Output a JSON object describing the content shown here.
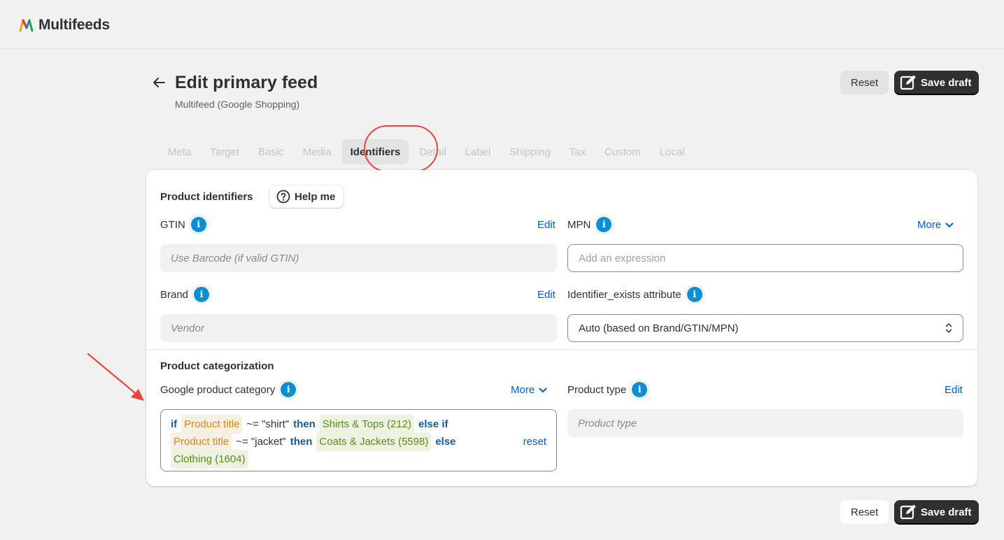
{
  "app": {
    "name": "Multifeeds"
  },
  "header": {
    "title": "Edit primary feed",
    "subtitle": "Multifeed (Google Shopping)",
    "reset_label": "Reset",
    "save_label": "Save draft"
  },
  "tabs": [
    {
      "label": "Meta",
      "active": false
    },
    {
      "label": "Target",
      "active": false
    },
    {
      "label": "Basic",
      "active": false
    },
    {
      "label": "Media",
      "active": false
    },
    {
      "label": "Identifiers",
      "active": true
    },
    {
      "label": "Detail",
      "active": false
    },
    {
      "label": "Label",
      "active": false
    },
    {
      "label": "Shipping",
      "active": false
    },
    {
      "label": "Tax",
      "active": false
    },
    {
      "label": "Custom",
      "active": false
    },
    {
      "label": "Local",
      "active": false
    }
  ],
  "identifiers": {
    "title": "Product identifiers",
    "help_label": "Help me",
    "gtin": {
      "label": "GTIN",
      "action": "Edit",
      "value": "Use Barcode (if valid GTIN)"
    },
    "mpn": {
      "label": "MPN",
      "action": "More",
      "placeholder": "Add an expression"
    },
    "brand": {
      "label": "Brand",
      "action": "Edit",
      "value": "Vendor"
    },
    "identifier_exists": {
      "label": "Identifier_exists attribute",
      "selected": "Auto (based on Brand/GTIN/MPN)"
    }
  },
  "categorization": {
    "title": "Product categorization",
    "google_category": {
      "label": "Google product category",
      "action": "More",
      "reset_label": "reset",
      "expression": {
        "kw_if": "if",
        "field1": "Product title",
        "op1": "~= \"shirt\"",
        "kw_then1": "then",
        "cat1": "Shirts & Tops (212)",
        "kw_elseif": "else if",
        "field2": "Product title",
        "op2": "~= \"jacket\"",
        "kw_then2": "then",
        "cat2": "Coats & Jackets (5598)",
        "kw_else": "else",
        "cat3": "Clothing (1604)"
      }
    },
    "product_type": {
      "label": "Product type",
      "action": "Edit",
      "value": "Product type"
    }
  },
  "colors": {
    "accent_link": "#005bd3",
    "info_icon": "#0a8fd6",
    "annotation_red": "#e5483a",
    "save_button": "#303030"
  }
}
